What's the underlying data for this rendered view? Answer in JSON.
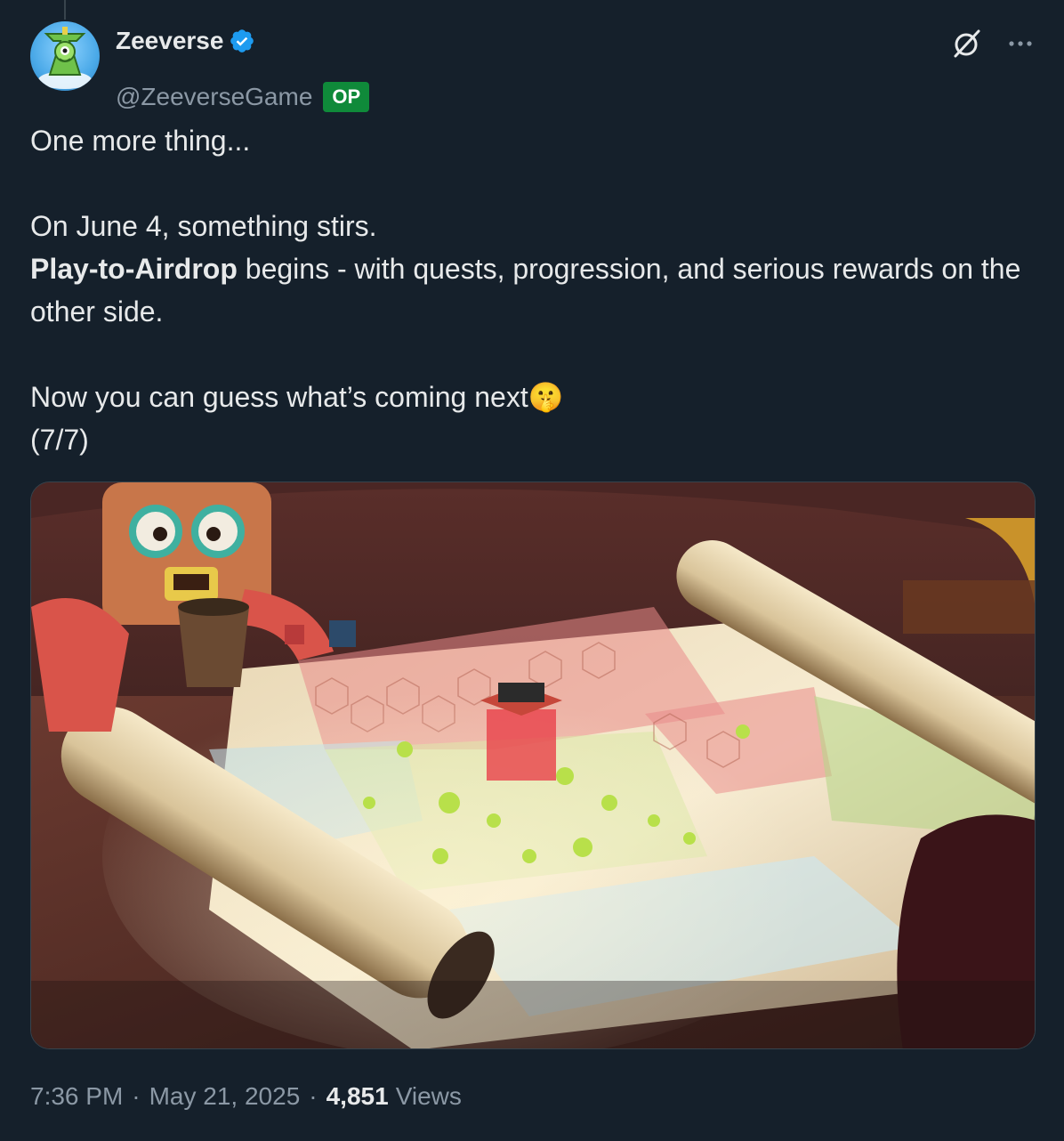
{
  "tweet": {
    "author": {
      "display_name": "Zeeverse",
      "handle": "@ZeeverseGame",
      "badge": "OP",
      "verified": true
    },
    "text": {
      "line1": "One more thing...",
      "line2": "On June 4, something stirs.",
      "line3_bold": "Play-to-Airdrop",
      "line3_rest": " begins - with quests, progression, and serious rewards on the other side.",
      "line4": "Now you can guess what’s coming next",
      "line4_emoji": "🤫",
      "line5": "(7/7)"
    },
    "meta": {
      "time": "7:36 PM",
      "date": "May 21, 2025",
      "views_count": "4,851",
      "views_label": "Views"
    }
  },
  "colors": {
    "background": "#15202b",
    "text": "#e7e9ea",
    "muted": "#8b98a5",
    "verified": "#1d9bf0",
    "op_badge": "#0f8a3a"
  },
  "icons": {
    "verified": "verified-badge-icon",
    "grok": "grok-icon",
    "more": "more-icon"
  }
}
